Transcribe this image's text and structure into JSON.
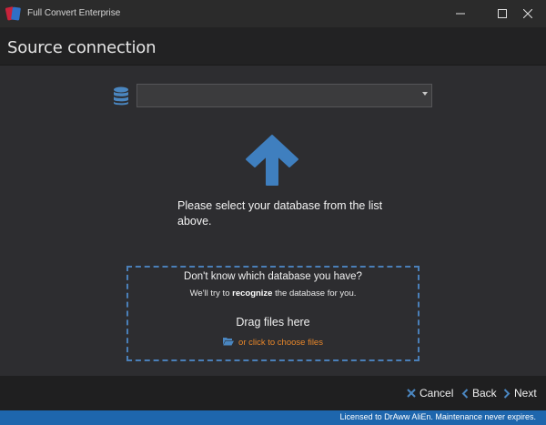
{
  "window": {
    "title": "Full Convert Enterprise"
  },
  "header": {
    "title": "Source connection"
  },
  "source": {
    "selected_database": ""
  },
  "prompt": {
    "text": "Please select your database from the list above."
  },
  "dropzone": {
    "question": "Don't know which database you have?",
    "hint_prefix": "We'll try to ",
    "hint_bold": "recognize",
    "hint_suffix": " the database for you.",
    "drag_label": "Drag files here",
    "choose_label": "or click to choose files"
  },
  "nav": {
    "cancel_label": "Cancel",
    "back_label": "Back",
    "next_label": "Next"
  },
  "status": {
    "text": "Licensed to DrAww AliEn. Maintenance never expires."
  },
  "colors": {
    "accent_blue": "#4a86c0",
    "status_bar": "#1e66ad",
    "link_orange": "#e8872a",
    "background": "#2d2d30"
  },
  "icons": {
    "app": "app-logo-icon",
    "database": "database-icon",
    "arrow": "arrow-up-icon",
    "folder": "folder-open-icon",
    "cancel": "close-x-icon",
    "back": "chevron-left-icon",
    "next": "chevron-right-icon"
  }
}
